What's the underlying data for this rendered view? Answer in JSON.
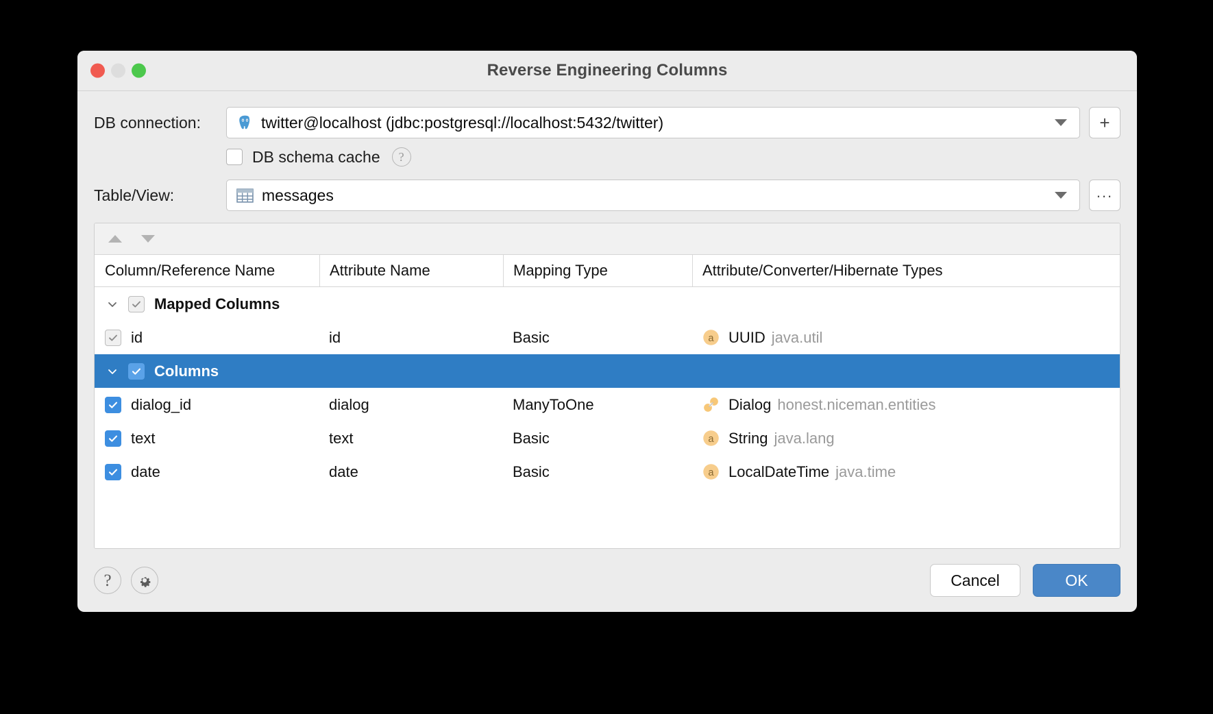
{
  "window": {
    "title": "Reverse Engineering Columns",
    "traffic_lights": [
      "close-button",
      "minimize-button",
      "zoom-button"
    ]
  },
  "form": {
    "db_connection_label": "DB connection:",
    "db_connection_value": "twitter@localhost (jdbc:postgresql://localhost:5432/twitter)",
    "db_connection_icon": "postgresql-elephant-icon",
    "add_connection_label": "+",
    "schema_cache_label": "DB schema cache",
    "schema_cache_checked": false,
    "schema_cache_help_label": "?",
    "table_view_label": "Table/View:",
    "table_view_value": "messages",
    "table_view_icon": "table-grid-icon",
    "browse_label": "..."
  },
  "table": {
    "toolbar": {
      "move_up_label": "move-up",
      "move_down_label": "move-down"
    },
    "headers": [
      "Column/Reference Name",
      "Attribute Name",
      "Mapping Type",
      "Attribute/Converter/Hibernate Types"
    ],
    "rows": [
      {
        "kind": "group",
        "name": "Mapped Columns",
        "attribute": "",
        "mapping": "",
        "type_icon": "",
        "type_name": "",
        "type_package": "",
        "checked": true,
        "checkbox_style": "gray",
        "expanded": true,
        "selected": false
      },
      {
        "kind": "leaf",
        "name": "id",
        "attribute": "id",
        "mapping": "Basic",
        "type_icon": "attribute-icon",
        "type_name": "UUID",
        "type_package": "java.util",
        "checked": true,
        "checkbox_style": "gray",
        "selected": false
      },
      {
        "kind": "group",
        "name": "Columns",
        "attribute": "",
        "mapping": "",
        "type_icon": "",
        "type_name": "",
        "type_package": "",
        "checked": true,
        "checkbox_style": "blue-on-sel",
        "expanded": true,
        "selected": true
      },
      {
        "kind": "leaf",
        "name": "dialog_id",
        "attribute": "dialog",
        "mapping": "ManyToOne",
        "type_icon": "entity-relation-icon",
        "type_name": "Dialog",
        "type_package": "honest.niceman.entities",
        "checked": true,
        "checkbox_style": "blue",
        "selected": false
      },
      {
        "kind": "leaf",
        "name": "text",
        "attribute": "text",
        "mapping": "Basic",
        "type_icon": "attribute-icon",
        "type_name": "String",
        "type_package": "java.lang",
        "checked": true,
        "checkbox_style": "blue",
        "selected": false
      },
      {
        "kind": "leaf",
        "name": "date",
        "attribute": "date",
        "mapping": "Basic",
        "type_icon": "attribute-icon",
        "type_name": "LocalDateTime",
        "type_package": "java.time",
        "checked": true,
        "checkbox_style": "blue",
        "selected": false
      }
    ]
  },
  "footer": {
    "help_label": "?",
    "settings_icon": "gear-icon",
    "cancel_label": "Cancel",
    "ok_label": "OK"
  },
  "colors": {
    "selection_blue": "#2f7dc4",
    "primary_button": "#4a87c8",
    "checkbox_blue": "#3d8ee0",
    "type_icon_orange": "#f7c777",
    "package_gray": "#9a9a9a"
  }
}
